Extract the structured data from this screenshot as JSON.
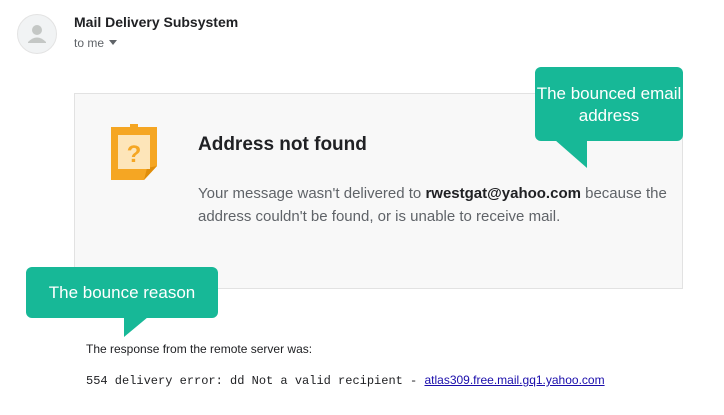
{
  "email": {
    "sender": "Mail Delivery Subsystem",
    "recipient_label": "to me"
  },
  "bounce_card": {
    "title": "Address not found",
    "message_prefix": "Your message wasn't delivered to ",
    "address": "rwestgat@yahoo.com",
    "message_suffix": " because the address couldn't be found, or is unable to receive mail."
  },
  "callouts": {
    "bounced_address": "The bounced email address",
    "bounce_reason": "The bounce reason"
  },
  "response": {
    "label": "The response from the remote server was:",
    "error_text": "554 delivery error: dd Not a valid recipient - ",
    "server_link": "atlas309.free.mail.gq1.yahoo.com"
  },
  "icons": {
    "avatar": "person-icon",
    "dropdown": "chevron-down-icon",
    "card": "question-note-icon"
  },
  "colors": {
    "callout": "#17b897",
    "card_background": "#f8f8f8",
    "note_icon": "#f5a623",
    "link": "#1a0dab"
  }
}
